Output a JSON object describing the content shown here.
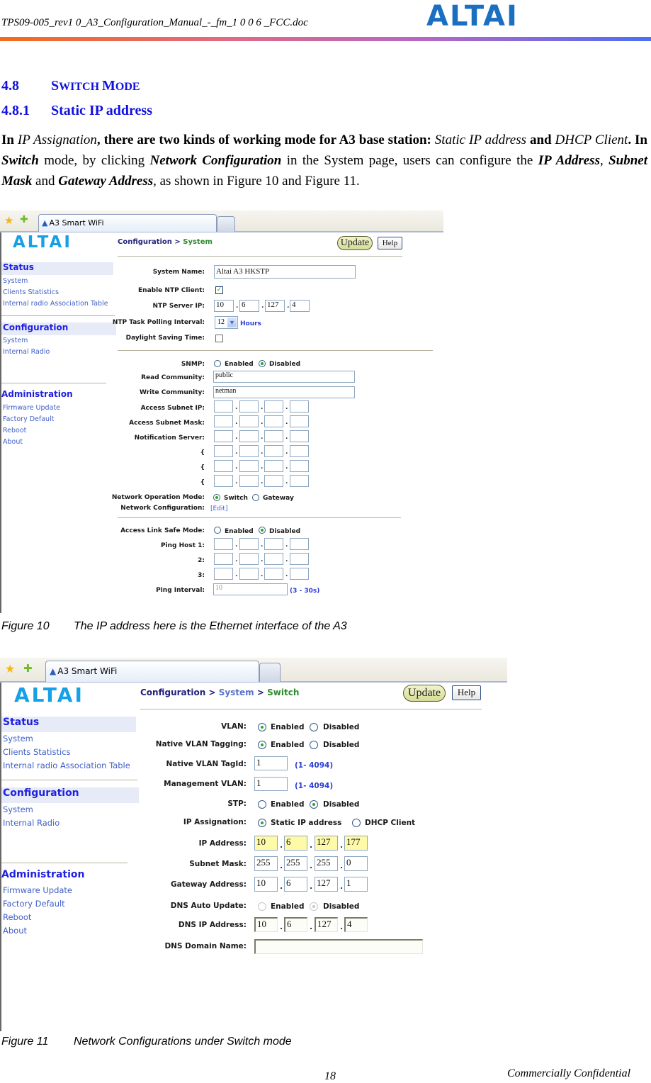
{
  "doc_header": {
    "file_name": "TPS09-005_rev1 0_A3_Configuration_Manual_-_fm_1 0 0 6 _FCC.doc",
    "logo_text": "ALTAI"
  },
  "section": {
    "number": "4.8",
    "title_first_cap": "S",
    "title_rest1": "WITCH ",
    "title_second_cap": "M",
    "title_rest2": "ODE"
  },
  "subsection": {
    "number": "4.8.1",
    "title": "Static IP address"
  },
  "paragraph": {
    "p1": "In ",
    "p2": "IP Assignation",
    "p3": ", there are two kinds of working mode for A3 base station: ",
    "p4": "Static IP address",
    "p5": " and ",
    "p6": "DHCP Client",
    "p7": ". In ",
    "p8": "Switch",
    "p9": " mode, by clicking ",
    "p10": "Network Configuration",
    "p11": " in the System page, users can configure the ",
    "p12": "IP Address",
    "p13": ", ",
    "p14": "Subnet Mask",
    "p15": " and ",
    "p16": "Gateway Address",
    "p17": ", as shown in Figure 10 and Figure 11."
  },
  "figure10": {
    "browser_tab_title": "A3 Smart WiFi",
    "logo": "ALTAI",
    "sidebar": {
      "status_heading": "Status",
      "status_items": [
        "System",
        "Clients Statistics",
        "Internal radio Association Table"
      ],
      "config_heading": "Configuration",
      "config_items": [
        "System",
        "Internal Radio"
      ],
      "admin_heading": "Administration",
      "admin_items": [
        "Firmware Update",
        "Factory Default",
        "Reboot",
        "About"
      ]
    },
    "breadcrumb": {
      "part1": "Configuration",
      "sep": " > ",
      "part2": "System"
    },
    "update_button": "Update",
    "help_button": "Help",
    "labels": {
      "system_name": "System Name:",
      "enable_ntp": "Enable NTP Client:",
      "ntp_server": "NTP Server IP:",
      "ntp_interval": "NTP Task Polling Interval:",
      "daylight": "Daylight Saving Time:",
      "snmp": "SNMP:",
      "read_community": "Read Community:",
      "write_community": "Write Community:",
      "access_subnet_ip": "Access Subnet IP:",
      "access_subnet_mask": "Access Subnet Mask:",
      "notification_server": "Notification Server:",
      "brace": "{",
      "net_op_mode": "Network Operation Mode:",
      "net_config": "Network Configuration:",
      "access_link_safe": "Access Link Safe Mode:",
      "ping_host1": "Ping Host 1:",
      "ping_host2": "2:",
      "ping_host3": "3:",
      "ping_interval": "Ping Interval:"
    },
    "values": {
      "system_name": "Altai A3 HKSTP",
      "enable_ntp_checked": true,
      "ntp_server": [
        "10",
        "6",
        "127",
        "4"
      ],
      "ntp_interval": "12",
      "ntp_interval_unit": "Hours",
      "daylight_checked": false,
      "snmp_enabled": "Enabled",
      "snmp_disabled": "Disabled",
      "snmp_selected": "Disabled",
      "read_community": "public",
      "write_community": "netman",
      "mode_switch": "Switch",
      "mode_gateway": "Gateway",
      "mode_selected": "Switch",
      "edit_link": "[Edit]",
      "safe_enabled": "Enabled",
      "safe_disabled": "Disabled",
      "safe_selected": "Disabled",
      "ping_interval": "10",
      "ping_interval_range": "(3 - 30s)"
    },
    "caption_num": "Figure 10",
    "caption_text": "The IP address here is the Ethernet interface of the A3"
  },
  "figure11": {
    "browser_tab_title": "A3 Smart WiFi",
    "logo": "ALTAI",
    "sidebar": {
      "status_heading": "Status",
      "status_items": [
        "System",
        "Clients Statistics",
        "Internal radio Association Table"
      ],
      "config_heading": "Configuration",
      "config_items": [
        "System",
        "Internal Radio"
      ],
      "admin_heading": "Administration",
      "admin_items": [
        "Firmware Update",
        "Factory Default",
        "Reboot",
        "About"
      ]
    },
    "breadcrumb": {
      "part1": "Configuration",
      "sep1": " > ",
      "part2": "System",
      "sep2": " > ",
      "part3": "Switch"
    },
    "update_button": "Update",
    "help_button": "Help",
    "labels": {
      "vlan": "VLAN:",
      "native_vlan_tagging": "Native VLAN Tagging:",
      "native_vlan_tagid": "Native VLAN TagId:",
      "management_vlan": "Management VLAN:",
      "stp": "STP:",
      "ip_assignation": "IP Assignation:",
      "ip_address": "IP Address:",
      "subnet_mask": "Subnet Mask:",
      "gateway_address": "Gateway Address:",
      "dns_auto_update": "DNS Auto Update:",
      "dns_ip_address": "DNS IP Address:",
      "dns_domain_name": "DNS Domain Name:"
    },
    "values": {
      "enabled": "Enabled",
      "disabled": "Disabled",
      "vlan_selected": "Enabled",
      "native_tagging_selected": "Enabled",
      "native_vlan_tagid": "1",
      "native_vlan_tagid_range": "(1- 4094)",
      "management_vlan": "1",
      "management_vlan_range": "(1- 4094)",
      "stp_selected": "Disabled",
      "static_ip": "Static IP address",
      "dhcp_client": "DHCP Client",
      "ip_assignation_selected": "Static IP address",
      "ip_address": [
        "10",
        "6",
        "127",
        "177"
      ],
      "subnet_mask": [
        "255",
        "255",
        "255",
        "0"
      ],
      "gateway_address": [
        "10",
        "6",
        "127",
        "1"
      ],
      "dns_auto_selected": "Disabled",
      "dns_ip_address": [
        "10",
        "6",
        "127",
        "4"
      ],
      "dns_domain_name": ""
    },
    "caption_num": "Figure 11",
    "caption_text": "Network Configurations under Switch mode"
  },
  "footer": {
    "page_number": "18",
    "confidentiality": "Commercially Confidential"
  },
  "colors": {
    "heading_blue": "#1010e0",
    "altai_blue": "#1a6fc0",
    "app_logo_blue": "#17a0e6",
    "link_blue": "#3f5fc6",
    "breadcrumb_green": "#2e8a2e",
    "highlight_yellow": "#fffaa8"
  }
}
